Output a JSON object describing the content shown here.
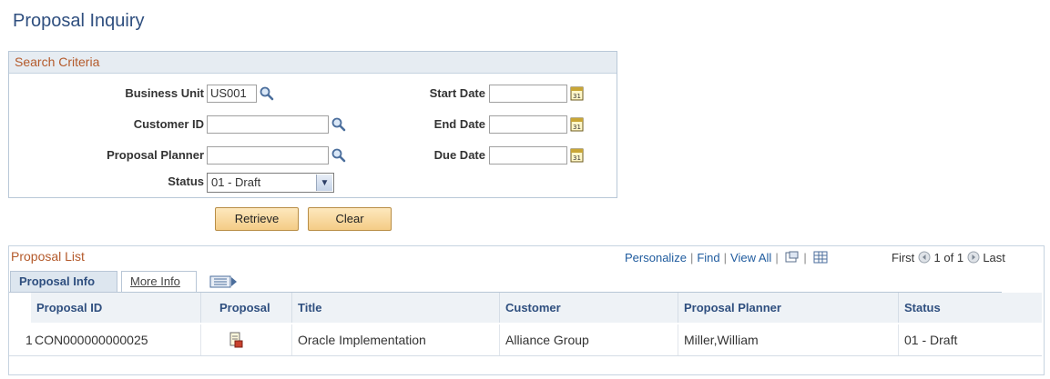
{
  "page": {
    "title": "Proposal Inquiry"
  },
  "search": {
    "header": "Search Criteria",
    "business_unit": {
      "label": "Business Unit",
      "value": "US001"
    },
    "customer_id": {
      "label": "Customer ID",
      "value": ""
    },
    "proposal_planner": {
      "label": "Proposal Planner",
      "value": ""
    },
    "status": {
      "label": "Status",
      "value": "01 - Draft"
    },
    "start_date": {
      "label": "Start Date",
      "value": ""
    },
    "end_date": {
      "label": "End Date",
      "value": ""
    },
    "due_date": {
      "label": "Due Date",
      "value": ""
    },
    "calendar_glyph": "31",
    "retrieve_label": "Retrieve",
    "clear_label": "Clear"
  },
  "grid": {
    "caption": "Proposal List",
    "nav": {
      "personalize": "Personalize",
      "find": "Find",
      "view_all": "View All",
      "first": "First",
      "range": "1 of 1",
      "last": "Last"
    },
    "tabs": [
      {
        "label": "Proposal Info"
      },
      {
        "label": "More Info"
      }
    ],
    "columns": [
      "Proposal ID",
      "Proposal",
      "Title",
      "Customer",
      "Proposal Planner",
      "Status"
    ],
    "rows": [
      {
        "num": "1",
        "proposal_id": "CON000000000025",
        "title": "Oracle Implementation",
        "customer": "Alliance Group",
        "planner": "Miller,William",
        "status": "01 - Draft"
      }
    ]
  },
  "icons": {
    "lookup": "magnifier-icon",
    "calendar": "calendar-icon",
    "dropdown": "chevron-down-icon",
    "document": "proposal-document-icon",
    "zoom": "new-window-icon",
    "download": "spreadsheet-download-icon",
    "first": "previous-arrow-icon",
    "last": "next-arrow-icon",
    "show_all_columns": "show-all-columns-icon"
  },
  "colors": {
    "title": "#2f4f7f",
    "section_header": "#b45a2b",
    "link": "#1f5b9e",
    "button_bg": "#f4cc86"
  }
}
